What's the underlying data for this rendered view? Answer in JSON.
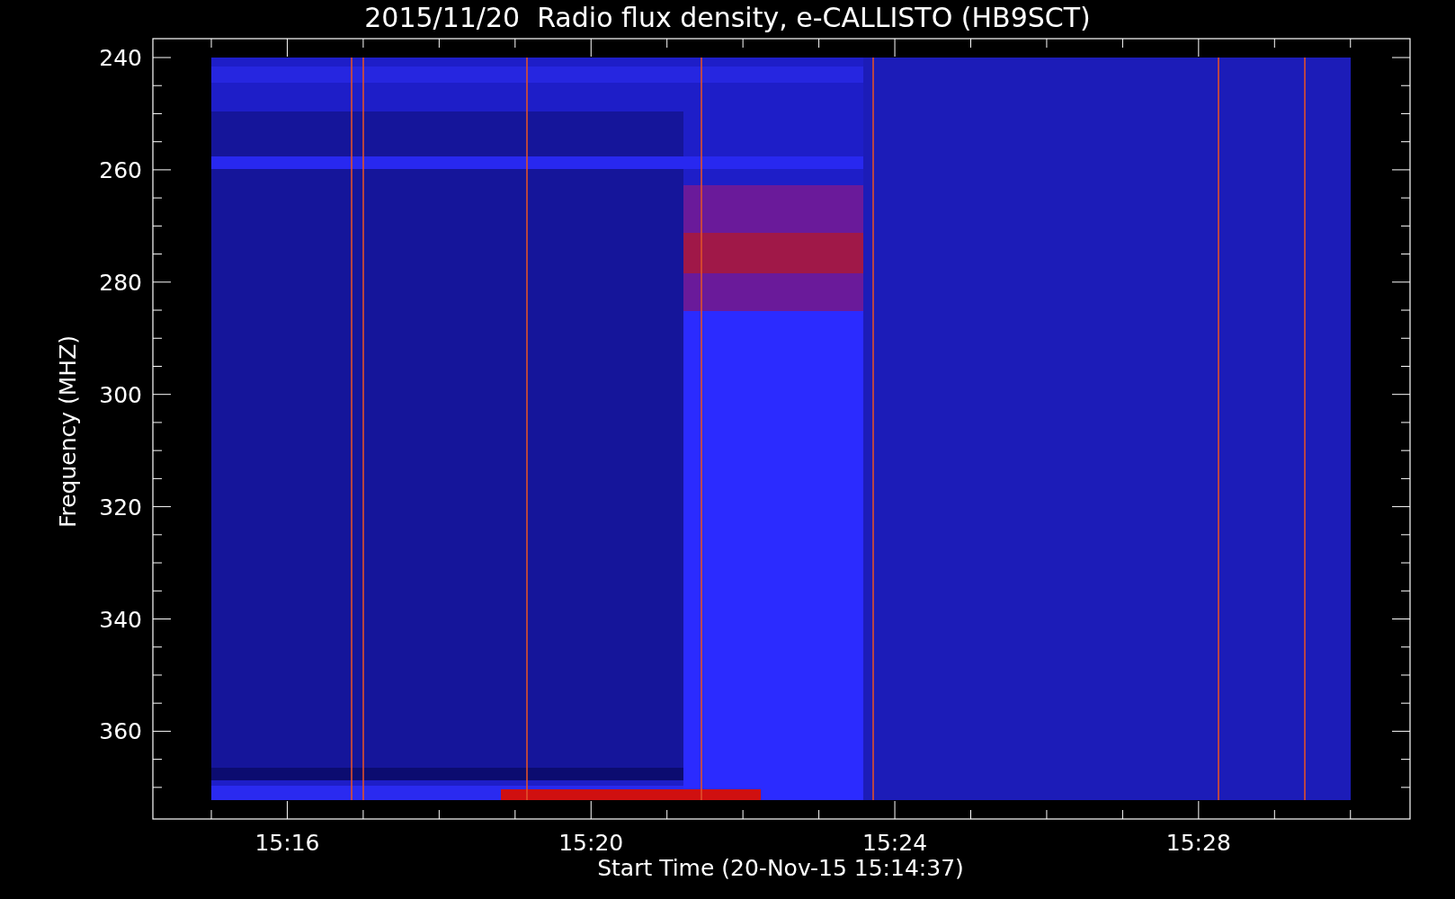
{
  "title": "2015/11/20  Radio flux density, e-CALLISTO (HB9SCT)",
  "ylabel": "Frequency (MHZ)",
  "xlabel": "Start Time (20-Nov-15 15:14:37)",
  "yticks": [
    "240",
    "260",
    "280",
    "300",
    "320",
    "340",
    "360"
  ],
  "xticks": [
    "15:16",
    "15:20",
    "15:24",
    "15:28"
  ]
}
